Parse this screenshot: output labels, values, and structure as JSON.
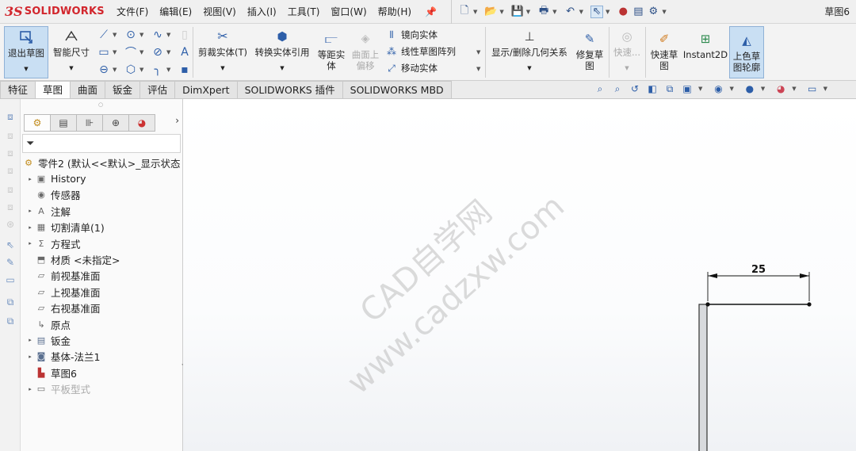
{
  "app": {
    "logo_prefix": "3S",
    "logo_text": "SOLIDWORKS",
    "document_title": "草图6"
  },
  "menu": [
    "文件(F)",
    "编辑(E)",
    "视图(V)",
    "插入(I)",
    "工具(T)",
    "窗口(W)",
    "帮助(H)"
  ],
  "commands": {
    "exit_sketch": "退出草图",
    "smart_dimension": "智能尺寸",
    "trim_entities": "剪裁实体(T)",
    "convert_entities": "转换实体引用",
    "offset_entities": "等距实\n体",
    "offset_surface": "曲面上\n偏移",
    "mirror_entities": "镜向实体",
    "linear_pattern": "线性草图阵列",
    "move_entities": "移动实体",
    "display_relations": "显示/删除几何关系",
    "repair_sketch": "修复草\n图",
    "quick_snaps_disabled": "快速...",
    "rapid_sketch": "快速草\n图",
    "instant2d": "Instant2D",
    "shaded_contours": "上色草\n图轮廓"
  },
  "tabs": [
    {
      "label": "特征",
      "active": false
    },
    {
      "label": "草图",
      "active": true
    },
    {
      "label": "曲面",
      "active": false
    },
    {
      "label": "钣金",
      "active": false
    },
    {
      "label": "评估",
      "active": false
    },
    {
      "label": "DimXpert",
      "active": false
    },
    {
      "label": "SOLIDWORKS 插件",
      "active": false
    },
    {
      "label": "SOLIDWORKS MBD",
      "active": false
    }
  ],
  "tree": {
    "root": "零件2 (默认<<默认>_显示状态",
    "items": [
      {
        "label": "History",
        "expandable": true,
        "icon": "history-icon"
      },
      {
        "label": "传感器",
        "expandable": false,
        "icon": "sensor-icon"
      },
      {
        "label": "注解",
        "expandable": true,
        "icon": "annotation-icon"
      },
      {
        "label": "切割清单(1)",
        "expandable": true,
        "icon": "cut-list-icon"
      },
      {
        "label": "方程式",
        "expandable": true,
        "icon": "equation-icon"
      },
      {
        "label": "材质 <未指定>",
        "expandable": false,
        "icon": "material-icon"
      },
      {
        "label": "前视基准面",
        "expandable": false,
        "icon": "plane-icon"
      },
      {
        "label": "上视基准面",
        "expandable": false,
        "icon": "plane-icon"
      },
      {
        "label": "右视基准面",
        "expandable": false,
        "icon": "plane-icon"
      },
      {
        "label": "原点",
        "expandable": false,
        "icon": "origin-icon"
      },
      {
        "label": "钣金",
        "expandable": true,
        "icon": "sheet-metal-icon"
      },
      {
        "label": "基体-法兰1",
        "expandable": true,
        "icon": "base-flange-icon"
      },
      {
        "label": "草图6",
        "expandable": false,
        "icon": "sketch-icon"
      },
      {
        "label": "平板型式",
        "expandable": true,
        "icon": "flat-pattern-icon",
        "dim": true
      }
    ]
  },
  "sketch": {
    "dimension_value": "25"
  },
  "watermark": {
    "line1": "CAD自学网",
    "line2": "www.cadzxw.com"
  }
}
